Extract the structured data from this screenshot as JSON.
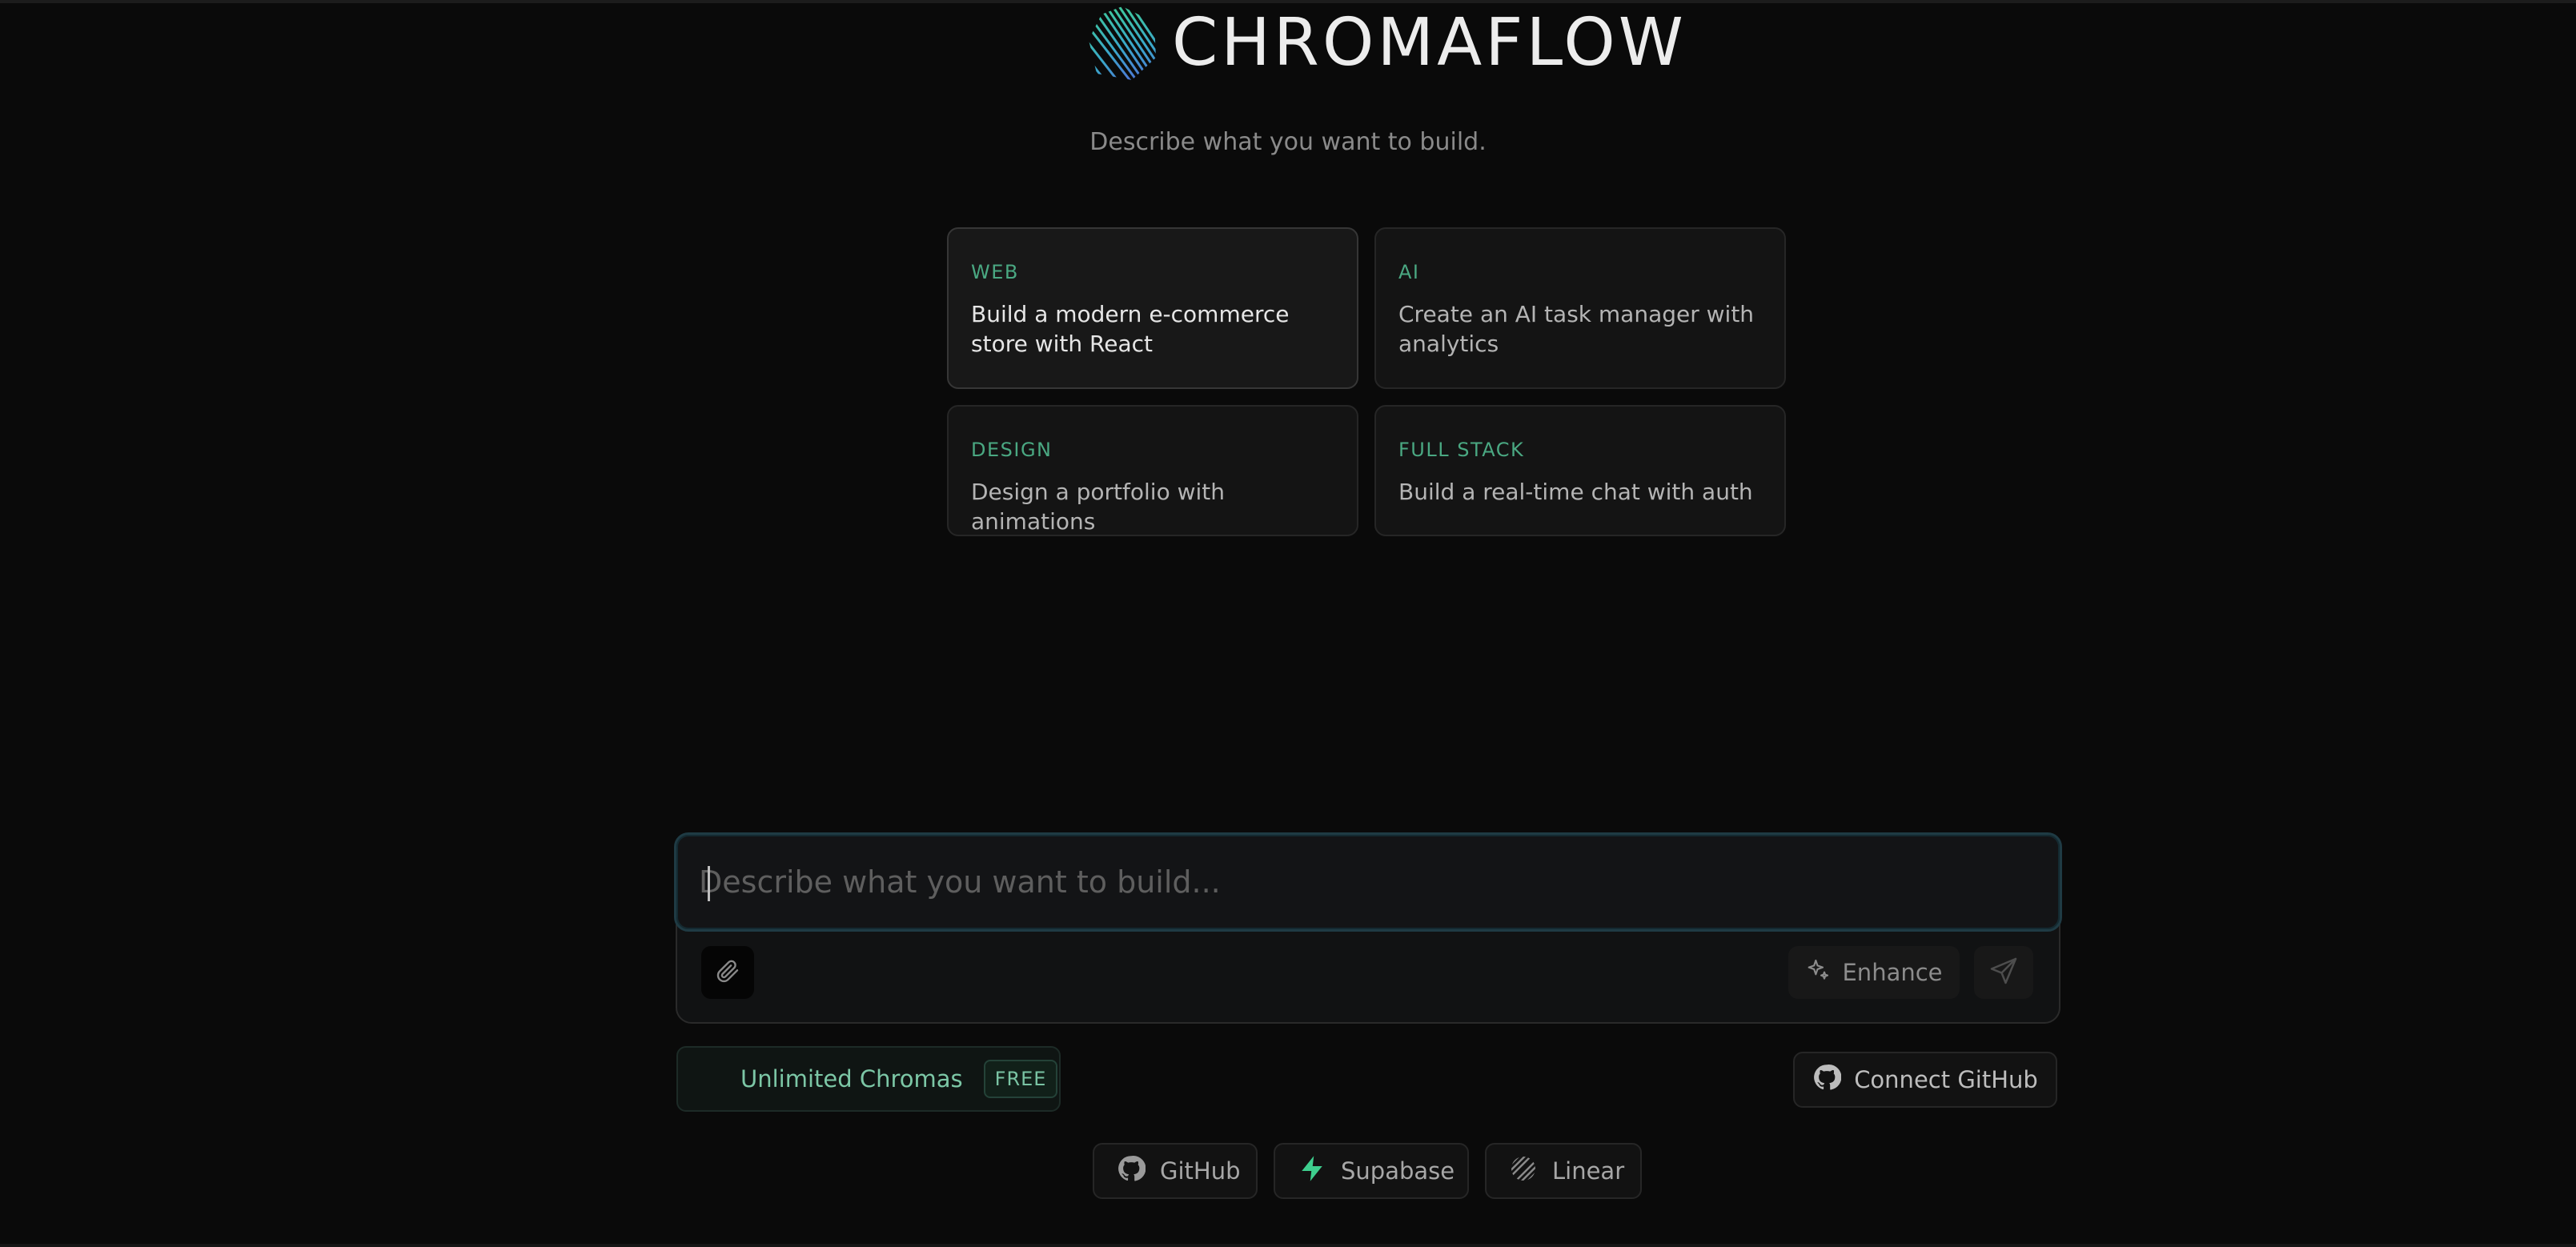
{
  "brand": {
    "name": "CHROMAFLOW",
    "logo_icon": "chromaflow-logo-icon"
  },
  "tagline": "Describe what you want to build.",
  "suggestions": [
    {
      "category": "WEB",
      "text": "Build a modern e-commerce store with React"
    },
    {
      "category": "AI",
      "text": "Create an AI task manager with analytics"
    },
    {
      "category": "DESIGN",
      "text": "Design a portfolio with animations"
    },
    {
      "category": "FULL STACK",
      "text": "Build a real-time chat with auth"
    }
  ],
  "prompt": {
    "placeholder": "Describe what you want to build...",
    "value": "",
    "enhance_label": "Enhance",
    "attach_icon": "paperclip-icon",
    "send_icon": "send-icon"
  },
  "credits": {
    "label": "Unlimited Chromas",
    "badge": "FREE"
  },
  "connect_github_label": "Connect GitHub",
  "integrations": [
    {
      "label": "GitHub",
      "icon": "github-icon"
    },
    {
      "label": "Supabase",
      "icon": "supabase-icon"
    },
    {
      "label": "Linear",
      "icon": "linear-icon"
    }
  ],
  "colors": {
    "background": "#0a0a0a",
    "accent_green": "#4aa882",
    "focus_ring": "#1f3b44"
  }
}
